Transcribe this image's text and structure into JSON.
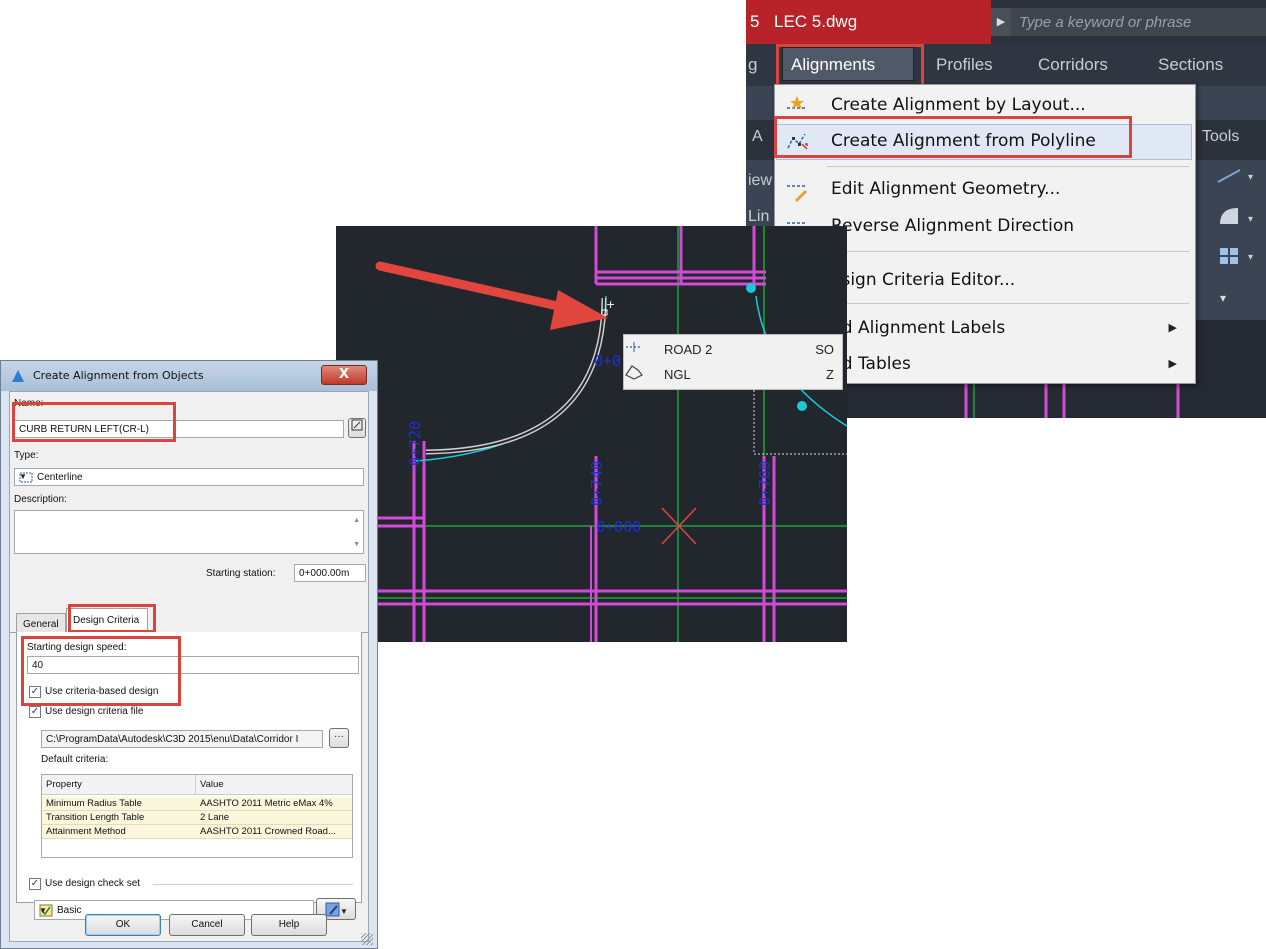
{
  "ribbon": {
    "title_prefix": "5",
    "file_name": "LEC 5.dwg",
    "search_placeholder": "Type a keyword or phrase",
    "tabs": {
      "left_fragment": "g",
      "alignments": "Alignments",
      "profiles": "Profiles",
      "corridors": "Corridors",
      "sections": "Sections"
    },
    "fragments": {
      "row_a": "A",
      "tools": "Tools",
      "iew": "iew",
      "lin": "Lin"
    }
  },
  "menu": {
    "items": [
      {
        "label": "Create Alignment by Layout...",
        "icon": "alignment-layout-icon"
      },
      {
        "label": "Create Alignment from Polyline",
        "icon": "alignment-polyline-icon"
      },
      {
        "label": "Edit Alignment Geometry...",
        "icon": "edit-geometry-icon"
      },
      {
        "label": "Reverse Alignment Direction",
        "icon": "reverse-direction-icon"
      },
      {
        "label": "esign Criteria Editor...",
        "icon": ""
      },
      {
        "label": "dd Alignment Labels",
        "icon": ""
      },
      {
        "label": "dd Tables",
        "icon": ""
      }
    ]
  },
  "cad": {
    "stations": {
      "left": "0+720",
      "middle": "0+740",
      "right": "0+760",
      "center": "0+000",
      "partial": "0+0"
    },
    "osnap": [
      {
        "label": "ROAD 2",
        "key": "SO",
        "icon": "alignment-icon"
      },
      {
        "label": "NGL",
        "key": "Z",
        "icon": "surface-icon"
      }
    ],
    "colors": {
      "background": "#22262d",
      "road_magenta": "#d24bd6",
      "grid_green": "#1fa33a",
      "cyan": "#19c9d6",
      "station_blue": "#1f2fd8",
      "arrow_red": "#e0463e"
    }
  },
  "dialog": {
    "title": "Create Alignment from Objects",
    "close": "X",
    "name_label": "Name:",
    "name_value": "CURB RETURN LEFT(CR-L)",
    "type_label": "Type:",
    "type_value": "Centerline",
    "description_label": "Description:",
    "description_value": "",
    "starting_station_label": "Starting station:",
    "starting_station_value": "0+000.00m",
    "tabs": {
      "general": "General",
      "design_criteria": "Design Criteria"
    },
    "speed_label": "Starting design speed:",
    "speed_value": "40",
    "criteria_based": {
      "label": "Use criteria-based design",
      "checked": true
    },
    "criteria_file": {
      "label": "Use design criteria file",
      "checked": true
    },
    "criteria_path": "C:\\ProgramData\\Autodesk\\C3D 2015\\enu\\Data\\Corridor I",
    "default_criteria_label": "Default criteria:",
    "grid": {
      "headers": [
        "Property",
        "Value"
      ],
      "rows": [
        {
          "property": "Minimum Radius Table",
          "value": "AASHTO 2011 Metric eMax 4%"
        },
        {
          "property": "Transition Length Table",
          "value": "2 Lane"
        },
        {
          "property": "Attainment Method",
          "value": "AASHTO 2011 Crowned Road..."
        }
      ]
    },
    "check_set": {
      "label": "Use design check set",
      "checked": true
    },
    "check_set_value": "Basic",
    "buttons": {
      "ok": "OK",
      "cancel": "Cancel",
      "help": "Help"
    }
  }
}
